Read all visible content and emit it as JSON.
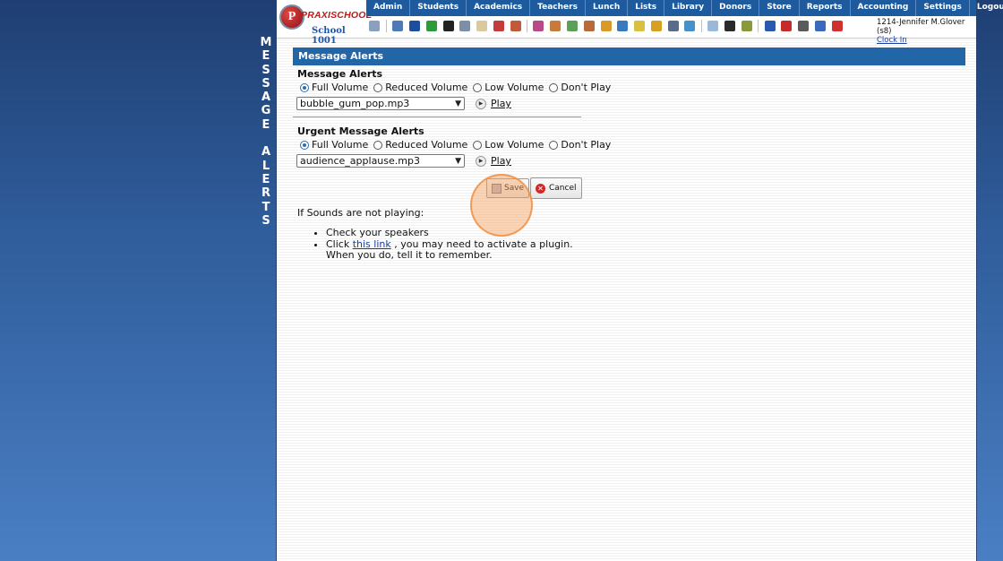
{
  "page": {
    "side_title_letters": [
      "M",
      "E",
      "S",
      "S",
      "A",
      "G",
      "E",
      "",
      "A",
      "L",
      "E",
      "R",
      "T",
      "S"
    ]
  },
  "logo": {
    "badge": "P",
    "brand": "PRAXISCHOOL",
    "school": "School 1001"
  },
  "nav": [
    "Admin",
    "Students",
    "Academics",
    "Teachers",
    "Lunch",
    "Lists",
    "Library",
    "Donors",
    "Store",
    "Reports",
    "Accounting",
    "Settings",
    "Logout"
  ],
  "toolbar_icons": [
    {
      "name": "search-icon",
      "color": "#8aa0c0"
    },
    {
      "name": "calendar-grid-icon",
      "color": "#4f7ab8"
    },
    {
      "name": "at-sign-icon",
      "color": "#1a4fa0"
    },
    {
      "name": "arrows-green-icon",
      "color": "#2e9b3a"
    },
    {
      "name": "phone-icon",
      "color": "#222222"
    },
    {
      "name": "speaker-icon",
      "color": "#7b8fa8"
    },
    {
      "name": "notepad-icon",
      "color": "#d9c9a0"
    },
    {
      "name": "calendar-red-icon",
      "color": "#c53a3a"
    },
    {
      "name": "megaphone-icon",
      "color": "#c05a3a"
    },
    {
      "name": "teacher-icon",
      "color": "#b84a8a"
    },
    {
      "name": "student-icon",
      "color": "#c87a3a"
    },
    {
      "name": "money-icon",
      "color": "#5aa05a"
    },
    {
      "name": "group-icon",
      "color": "#b86a3a"
    },
    {
      "name": "lunch-icon",
      "color": "#d99a2a"
    },
    {
      "name": "book-icon",
      "color": "#3a7ac0"
    },
    {
      "name": "pencil-icon",
      "color": "#d8c040"
    },
    {
      "name": "export-icon",
      "color": "#d8a020"
    },
    {
      "name": "users-icon",
      "color": "#5a6a8a"
    },
    {
      "name": "clock-icon",
      "color": "#4a90c8"
    },
    {
      "name": "window-icon",
      "color": "#9ab8d8"
    },
    {
      "name": "battery-icon",
      "color": "#2a2a2a"
    },
    {
      "name": "printer-icon",
      "color": "#8a9a3a"
    },
    {
      "name": "ap-icon",
      "color": "#2a5ab0"
    },
    {
      "name": "pdf-icon",
      "color": "#c82a2a"
    },
    {
      "name": "register-icon",
      "color": "#5a5a5a"
    },
    {
      "name": "help-icon",
      "color": "#3a6ac0"
    },
    {
      "name": "power-icon",
      "color": "#d03030"
    }
  ],
  "user": {
    "name": "1214-Jennifer M.Glover (s8)",
    "clock_in": "Clock In"
  },
  "panel": {
    "title": "Message Alerts"
  },
  "message_alerts": {
    "title": "Message Alerts",
    "options": [
      "Full Volume",
      "Reduced Volume",
      "Low Volume",
      "Don't Play"
    ],
    "selected": "Full Volume",
    "sound": "bubble_gum_pop.mp3",
    "play_label": "Play"
  },
  "urgent_alerts": {
    "title": "Urgent Message Alerts",
    "options": [
      "Full Volume",
      "Reduced Volume",
      "Low Volume",
      "Don't Play"
    ],
    "selected": "Full Volume",
    "sound": "audience_applause.mp3",
    "play_label": "Play"
  },
  "actions": {
    "save": "Save",
    "cancel": "Cancel"
  },
  "help": {
    "intro": "If Sounds are not playing:",
    "item1": "Check your speakers",
    "item2_pre": "Click ",
    "item2_link": "this link",
    "item2_post": " , you may need to activate a plugin.",
    "item2_line2": "When you do, tell it to remember."
  }
}
